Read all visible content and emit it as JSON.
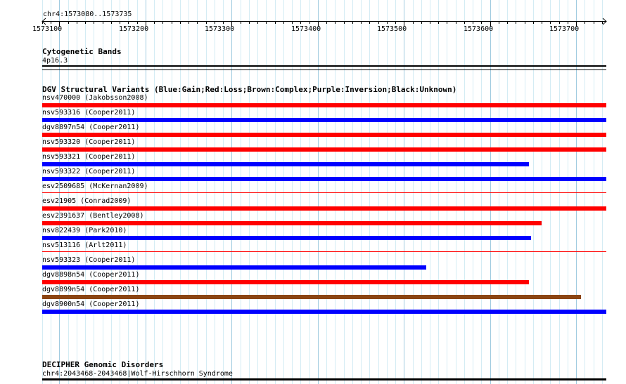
{
  "ruler": {
    "region": "chr4:1573080..1573735",
    "start": 1573080,
    "end": 1573735,
    "ticks": [
      1573100,
      1573200,
      1573300,
      1573400,
      1573500,
      1573600,
      1573700
    ]
  },
  "grid_minor_step": 10,
  "grid_major_step": 100,
  "colors": {
    "grid_minor": "#d4ecf4",
    "grid_major": "#a0cbe0",
    "gain": "#0000ff",
    "loss": "#ff0000",
    "complex": "#8b4513",
    "inversion": "#800080",
    "unknown": "#000000"
  },
  "cytoband": {
    "title": "Cytogenetic Bands",
    "band": "4p16.3"
  },
  "dgv": {
    "title": "DGV Structural Variants (Blue:Gain;Red:Loss;Brown:Complex;Purple:Inversion;Black:Unknown)",
    "variants": [
      {
        "label": "nsv470000 (Jakobsson2008)",
        "type": "loss",
        "start": 1573080,
        "end": 1573735,
        "thin": false
      },
      {
        "label": "nsv593316 (Cooper2011)",
        "type": "gain",
        "start": 1573080,
        "end": 1573735,
        "thin": false
      },
      {
        "label": "dgv8897n54 (Cooper2011)",
        "type": "loss",
        "start": 1573080,
        "end": 1573735,
        "thin": false
      },
      {
        "label": "nsv593320 (Cooper2011)",
        "type": "loss",
        "start": 1573080,
        "end": 1573735,
        "thin": false
      },
      {
        "label": "nsv593321 (Cooper2011)",
        "type": "gain",
        "start": 1573080,
        "end": 1573645,
        "thin": false
      },
      {
        "label": "nsv593322 (Cooper2011)",
        "type": "gain",
        "start": 1573080,
        "end": 1573735,
        "thin": false
      },
      {
        "label": "esv2509685 (McKernan2009)",
        "type": "loss",
        "start": 1573080,
        "end": 1573735,
        "thin": true
      },
      {
        "label": "esv21905 (Conrad2009)",
        "type": "loss",
        "start": 1573080,
        "end": 1573735,
        "thin": false
      },
      {
        "label": "esv2391637 (Bentley2008)",
        "type": "loss",
        "start": 1573080,
        "end": 1573660,
        "thin": false
      },
      {
        "label": "nsv822439 (Park2010)",
        "type": "gain",
        "start": 1573080,
        "end": 1573648,
        "thin": false
      },
      {
        "label": "nsv513116 (Arlt2011)",
        "type": "loss",
        "start": 1573080,
        "end": 1573735,
        "thin": true
      },
      {
        "label": "nsv593323 (Cooper2011)",
        "type": "gain",
        "start": 1573080,
        "end": 1573526,
        "thin": false
      },
      {
        "label": "dgv8898n54 (Cooper2011)",
        "type": "loss",
        "start": 1573080,
        "end": 1573645,
        "thin": false
      },
      {
        "label": "dgv8899n54 (Cooper2011)",
        "type": "complex",
        "start": 1573080,
        "end": 1573706,
        "thin": false
      },
      {
        "label": "dgv8900n54 (Cooper2011)",
        "type": "gain",
        "start": 1573080,
        "end": 1573735,
        "thin": false
      }
    ]
  },
  "decipher": {
    "title": "DECIPHER Genomic Disorders",
    "feature": "chr4:2043468-2043468|Wolf-Hirschhorn Syndrome"
  }
}
